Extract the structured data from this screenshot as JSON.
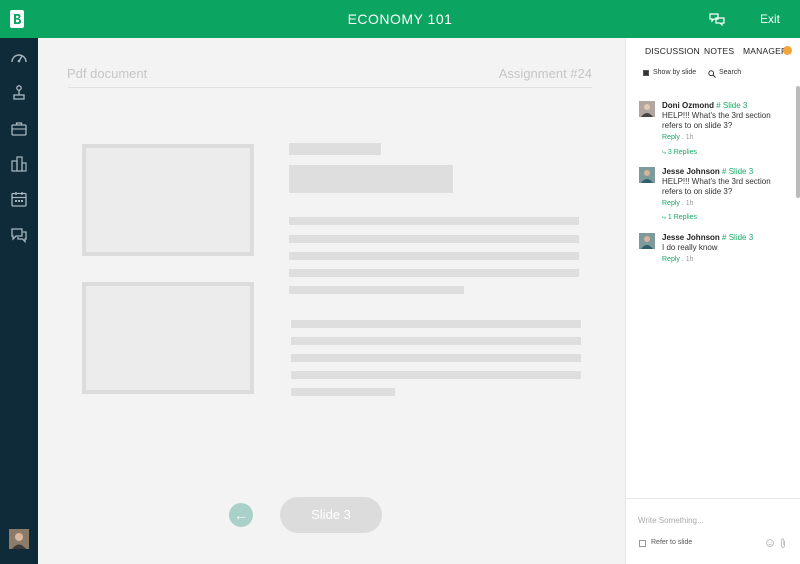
{
  "app": {
    "title": "ECONOMY 101",
    "exit_label": "Exit",
    "accent_color": "#0ba460",
    "sidebar_color": "#0f2a38",
    "icons": [
      "logo-icon",
      "chat-toggle-icon"
    ]
  },
  "sidebar": {
    "items": [
      {
        "icon": "dashboard-gauge-icon"
      },
      {
        "icon": "tools-icon"
      },
      {
        "icon": "briefcase-icon"
      },
      {
        "icon": "buildings-icon"
      },
      {
        "icon": "calendar-icon"
      },
      {
        "icon": "chat-bubbles-icon"
      }
    ]
  },
  "document": {
    "title": "Pdf document",
    "assignment": "Assignment #24",
    "slide_label": "Slide 3"
  },
  "panel": {
    "tabs": [
      {
        "label": "DISCUSSION",
        "active": false
      },
      {
        "label": "NOTES",
        "active": false
      },
      {
        "label": "MANAGER",
        "active": true
      }
    ],
    "badge_color": "#f3a43b",
    "show_by_slide_label": "Show by slide",
    "show_by_slide_checked": true,
    "search_label": "Search",
    "comments": [
      {
        "author": "Doni Ozmond",
        "slide": "# Slide 3",
        "text": "HELP!!! What's the 3rd section refers to on slide 3?",
        "reply_label": "Reply",
        "time": "1h",
        "replies": "3 Replies"
      },
      {
        "author": "Jesse Johnson",
        "slide": "# Slide 3",
        "text": "HELP!!! What's the 3rd section refers to on slide 3?",
        "reply_label": "Reply",
        "time": "1h",
        "replies": "1 Replies"
      },
      {
        "author": "Jesse Johnson",
        "slide": "# Slide 3",
        "text": "I do really know",
        "reply_label": "Reply",
        "time": "1h"
      }
    ],
    "compose_placeholder": "Write Something...",
    "refer_label": "Refer to slide"
  }
}
